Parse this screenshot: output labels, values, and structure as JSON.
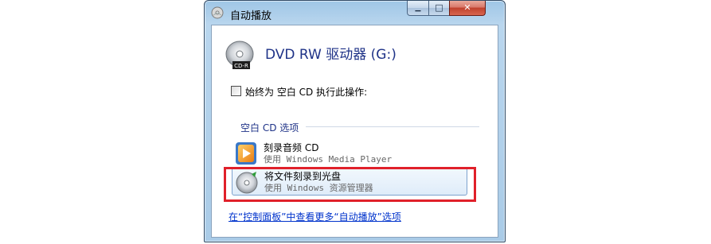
{
  "window": {
    "title": "自动播放"
  },
  "caption_buttons": {
    "minimize": {
      "glyph": "▁"
    },
    "maximize": {
      "glyph": "□"
    },
    "close": {
      "glyph": "✕"
    }
  },
  "drive": {
    "title": "DVD RW 驱动器 (G:)",
    "icon": "cd-rw-disc-icon",
    "disc_label": "CD-R"
  },
  "always_do": {
    "checked": false,
    "label": "始终为 空白 CD 执行此操作:"
  },
  "options_group": {
    "header": "空白 CD 选项",
    "items": [
      {
        "title": "刻录音频 CD",
        "subtitle": "使用 Windows Media Player",
        "icon": "media-player-icon",
        "selected": false
      },
      {
        "title": "将文件刻录到光盘",
        "subtitle": "使用 Windows 资源管理器",
        "icon": "disc-burn-icon",
        "selected": true
      }
    ]
  },
  "more_link": "在“控制面板”中查看更多“自动播放”选项",
  "colors": {
    "title_blue": "#1e3287",
    "link_blue": "#0033cc",
    "highlight_red": "#e0202a",
    "close_red": "#c0412d"
  }
}
